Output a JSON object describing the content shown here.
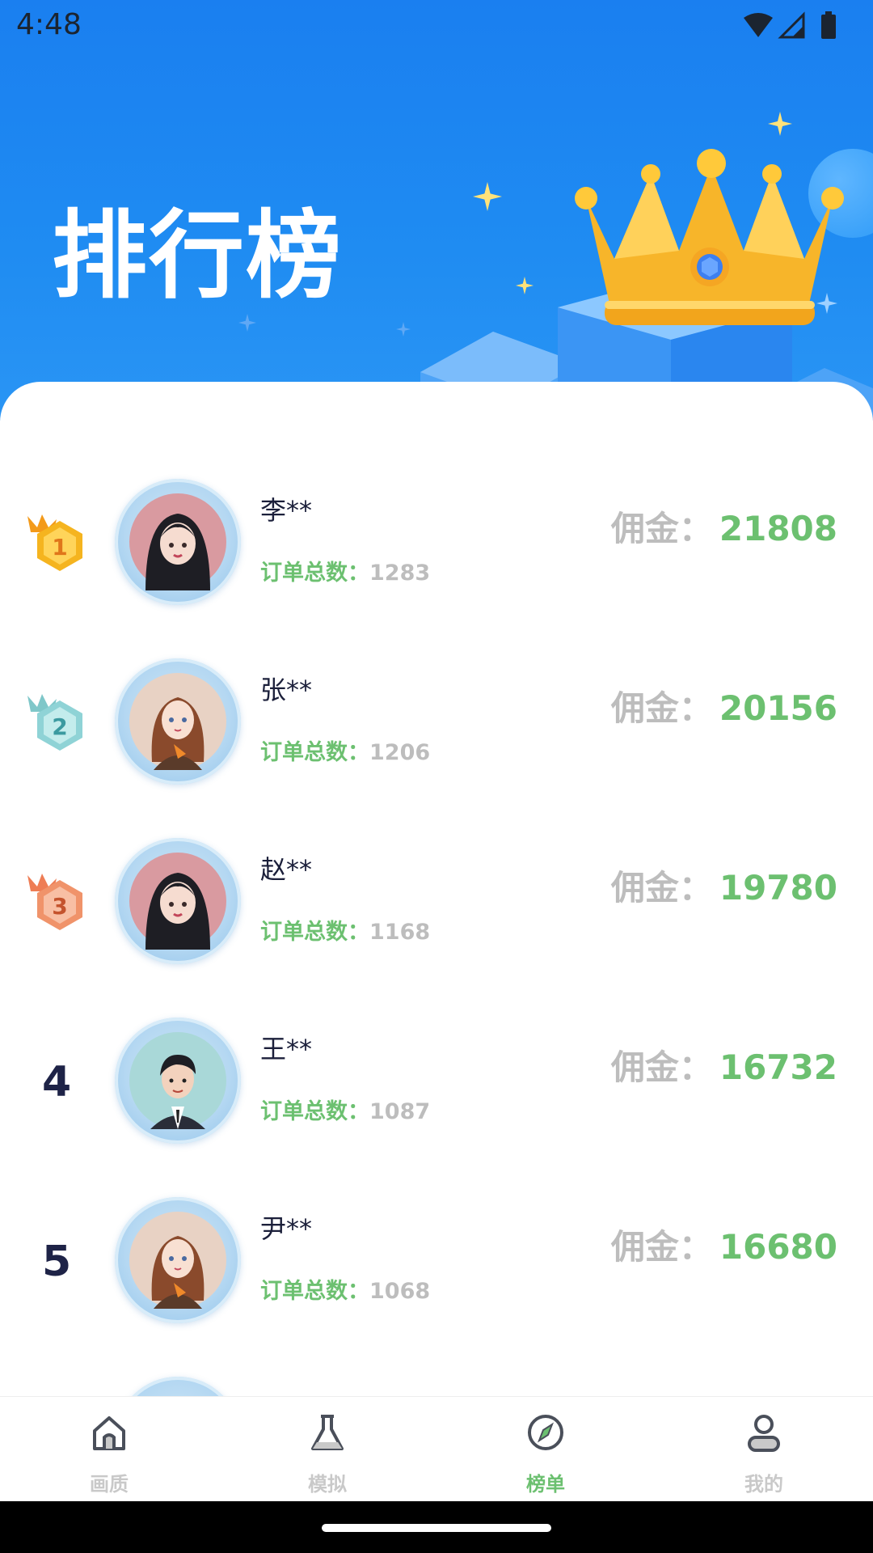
{
  "status_bar": {
    "time": "4:48"
  },
  "header": {
    "title": "排行榜"
  },
  "ranking": [
    {
      "rank": "1",
      "name": "李**",
      "orders_label": "订单总数：",
      "orders": "1283",
      "commission_label": "佣金：",
      "commission": "21808",
      "badge_color": "#f5b41f"
    },
    {
      "rank": "2",
      "name": "张**",
      "orders_label": "订单总数：",
      "orders": "1206",
      "commission_label": "佣金：",
      "commission": "20156",
      "badge_color": "#8fd3d6"
    },
    {
      "rank": "3",
      "name": "赵**",
      "orders_label": "订单总数：",
      "orders": "1168",
      "commission_label": "佣金：",
      "commission": "19780",
      "badge_color": "#f0936a"
    },
    {
      "rank": "4",
      "name": "王**",
      "orders_label": "订单总数：",
      "orders": "1087",
      "commission_label": "佣金：",
      "commission": "16732"
    },
    {
      "rank": "5",
      "name": "尹**",
      "orders_label": "订单总数：",
      "orders": "1068",
      "commission_label": "佣金：",
      "commission": "16680"
    }
  ],
  "bottom_nav": {
    "items": [
      {
        "label": "画质",
        "icon": "home-icon"
      },
      {
        "label": "模拟",
        "icon": "flask-icon"
      },
      {
        "label": "榜单",
        "icon": "compass-icon",
        "active": true
      },
      {
        "label": "我的",
        "icon": "user-icon"
      }
    ]
  },
  "colors": {
    "accent_green": "#6cc070",
    "header_blue": "#1a7ff0",
    "muted_gray": "#bdbdbd"
  }
}
